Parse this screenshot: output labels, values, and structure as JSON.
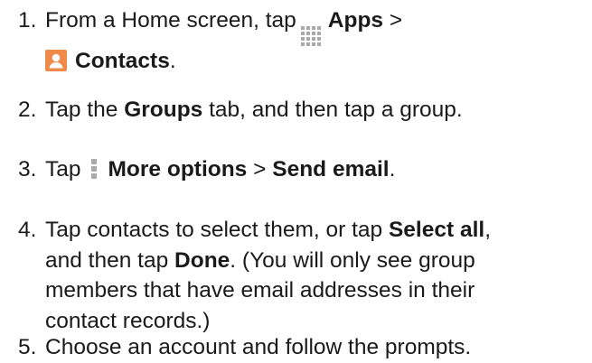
{
  "colors": {
    "text": "#1a1a1a",
    "apps_icon": "#a9a9a9",
    "contacts_icon": "#f08a4b",
    "more_icon": "#a9a9a9"
  },
  "icons": {
    "apps": "apps-grid-icon",
    "contacts": "contacts-icon",
    "more": "more-options-icon"
  },
  "steps": [
    {
      "number": "1.",
      "t1": "From a Home screen, tap",
      "b1": "Apps",
      "t2": ">",
      "b2": "Contacts",
      "t3": "."
    },
    {
      "number": "2.",
      "t1": "Tap the",
      "b1": "Groups",
      "t2": "tab, and then tap a group."
    },
    {
      "number": "3.",
      "t1": "Tap",
      "b1": "More options",
      "t2": ">",
      "b2": "Send email",
      "t3": "."
    },
    {
      "number": "4.",
      "t1": "Tap contacts to select them, or tap",
      "b1": "Select all",
      "t2": ",",
      "t3": "and then tap",
      "b2": "Done",
      "t4": ". (You will only see group",
      "t5": "members that have email addresses in their",
      "t6": "contact records.)"
    },
    {
      "number": "5.",
      "t1": "Choose an account and follow the prompts."
    }
  ]
}
